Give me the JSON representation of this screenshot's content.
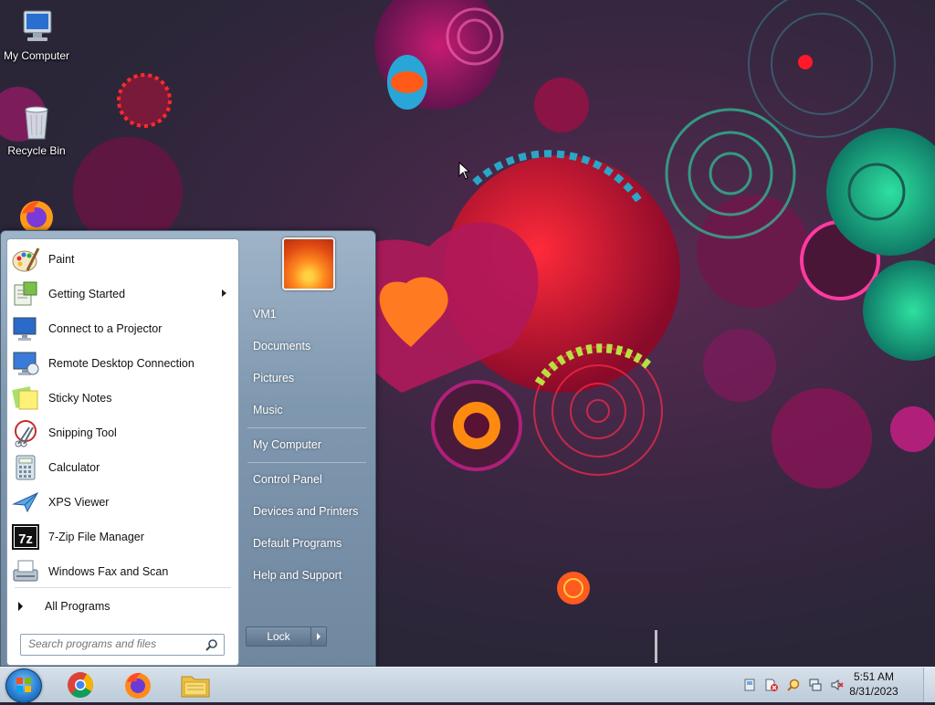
{
  "desktop": {
    "icons": [
      {
        "label": "My Computer",
        "icon": "my-computer-icon"
      },
      {
        "label": "Recycle Bin",
        "icon": "recycle-bin-icon"
      },
      {
        "label": "",
        "icon": "firefox-icon"
      }
    ]
  },
  "start_menu": {
    "programs": [
      {
        "label": "Paint",
        "icon": "paint-icon",
        "has_submenu": false
      },
      {
        "label": "Getting Started",
        "icon": "getting-started-icon",
        "has_submenu": true
      },
      {
        "label": "Connect to a Projector",
        "icon": "projector-icon",
        "has_submenu": false
      },
      {
        "label": "Remote Desktop Connection",
        "icon": "remote-desktop-icon",
        "has_submenu": false
      },
      {
        "label": "Sticky Notes",
        "icon": "sticky-notes-icon",
        "has_submenu": false
      },
      {
        "label": "Snipping Tool",
        "icon": "snipping-tool-icon",
        "has_submenu": false
      },
      {
        "label": "Calculator",
        "icon": "calculator-icon",
        "has_submenu": false
      },
      {
        "label": "XPS Viewer",
        "icon": "xps-viewer-icon",
        "has_submenu": false
      },
      {
        "label": "7-Zip File Manager",
        "icon": "7zip-icon",
        "has_submenu": false
      },
      {
        "label": "Windows Fax and Scan",
        "icon": "fax-scan-icon",
        "has_submenu": false
      }
    ],
    "all_programs_label": "All Programs",
    "search_placeholder": "Search programs and files",
    "places": [
      {
        "label": "VM1"
      },
      {
        "label": "Documents"
      },
      {
        "label": "Pictures"
      },
      {
        "label": "Music"
      },
      {
        "label": "My Computer"
      },
      {
        "label": "Control Panel"
      },
      {
        "label": "Devices and Printers"
      },
      {
        "label": "Default Programs"
      },
      {
        "label": "Help and Support"
      }
    ],
    "lock_label": "Lock"
  },
  "taskbar": {
    "apps": [
      {
        "name": "chrome-icon"
      },
      {
        "name": "firefox-icon"
      },
      {
        "name": "file-explorer-icon"
      }
    ],
    "tray_icons": [
      "action-center-icon",
      "network-error-icon",
      "search-magnifier-icon",
      "network-icon",
      "volume-muted-icon"
    ],
    "clock": {
      "time": "5:51 AM",
      "date": "8/31/2023"
    }
  }
}
